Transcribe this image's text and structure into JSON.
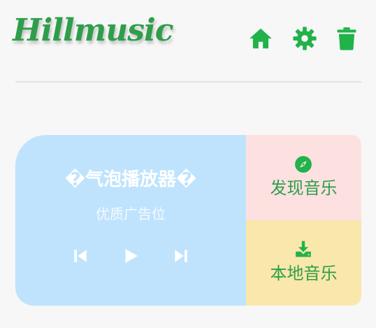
{
  "header": {
    "logo": "Hillmusic",
    "icons": [
      "home-icon",
      "settings-gear-icon",
      "trash-icon"
    ]
  },
  "player": {
    "title": "�气泡播放器�",
    "subtitle": "优质广告位",
    "controls": [
      "skip-previous-icon",
      "play-icon",
      "skip-next-icon"
    ]
  },
  "tiles": {
    "discover": {
      "label": "发现音乐",
      "icon": "compass-icon"
    },
    "local": {
      "label": "本地音乐",
      "icon": "download-icon"
    }
  },
  "colors": {
    "brand_green": "#2e9e4a",
    "icon_green": "#21b24a",
    "player_bg": "#bfe3fd",
    "discover_bg": "#fde0e0",
    "local_bg": "#f9e7ab",
    "page_bg": "#f7f7f7"
  }
}
